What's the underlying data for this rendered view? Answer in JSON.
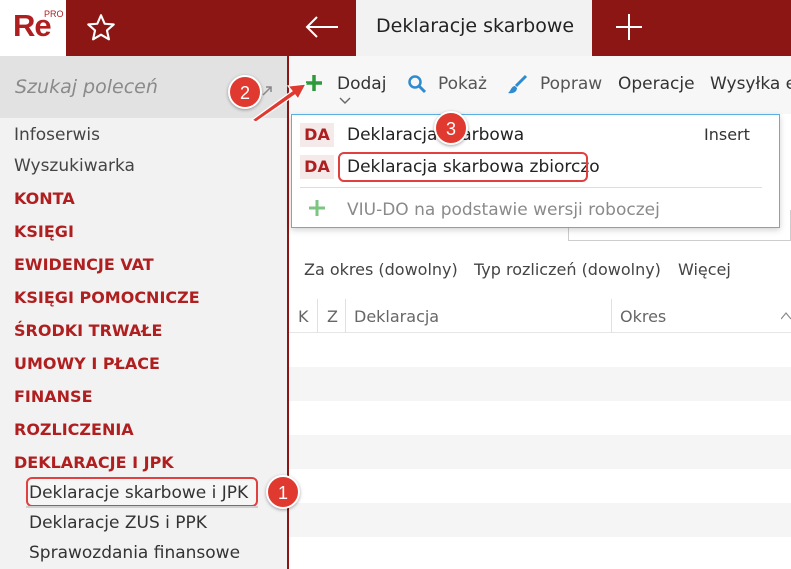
{
  "app": {
    "logo_text": "Re",
    "logo_badge": "PRO"
  },
  "header": {
    "active_tab": "Deklaracje skarbowe"
  },
  "search": {
    "placeholder": "Szukaj poleceń"
  },
  "sidebar": {
    "items": [
      {
        "label": "Infoserwis",
        "kind": "plain"
      },
      {
        "label": "Wyszukiwarka",
        "kind": "plain"
      },
      {
        "label": "KONTA",
        "kind": "cat"
      },
      {
        "label": "KSIĘGI",
        "kind": "cat"
      },
      {
        "label": "EWIDENCJE VAT",
        "kind": "cat"
      },
      {
        "label": "KSIĘGI POMOCNICZE",
        "kind": "cat"
      },
      {
        "label": "ŚRODKI TRWAŁE",
        "kind": "cat"
      },
      {
        "label": "UMOWY I PŁACE",
        "kind": "cat"
      },
      {
        "label": "FINANSE",
        "kind": "cat"
      },
      {
        "label": "ROZLICZENIA",
        "kind": "cat"
      },
      {
        "label": "DEKLARACJE I JPK",
        "kind": "cat"
      },
      {
        "label": "Deklaracje skarbowe i JPK",
        "kind": "sub"
      },
      {
        "label": "Deklaracje ZUS i PPK",
        "kind": "sub"
      },
      {
        "label": "Sprawozdania finansowe",
        "kind": "sub"
      }
    ]
  },
  "toolbar": {
    "dodaj": "Dodaj",
    "pokaz": "Pokaż",
    "popraw": "Popraw",
    "operacje": "Operacje",
    "wysylka": "Wysyłka el"
  },
  "dropdown": {
    "items": [
      {
        "badge": "DA",
        "label": "Deklaracja skarbowa",
        "shortcut": "Insert"
      },
      {
        "badge": "DA",
        "label": "Deklaracja skarbowa zbiorczo",
        "shortcut": ""
      },
      {
        "badge": "",
        "label": "VIU-DO na podstawie wersji roboczej",
        "shortcut": ""
      }
    ]
  },
  "filters": [
    "Za okres (dowolny)",
    "Typ rozliczeń (dowolny)",
    "Więcej"
  ],
  "grid": {
    "columns": [
      "K",
      "Z",
      "Deklaracja",
      "Okres"
    ]
  },
  "badges": [
    "1",
    "2",
    "3"
  ],
  "colors": {
    "brand": "#8c1614",
    "accent_red": "#b01f20",
    "callout": "#e03a30",
    "plus_green": "#2e9a3a",
    "blue_icon": "#2e8bd0"
  }
}
